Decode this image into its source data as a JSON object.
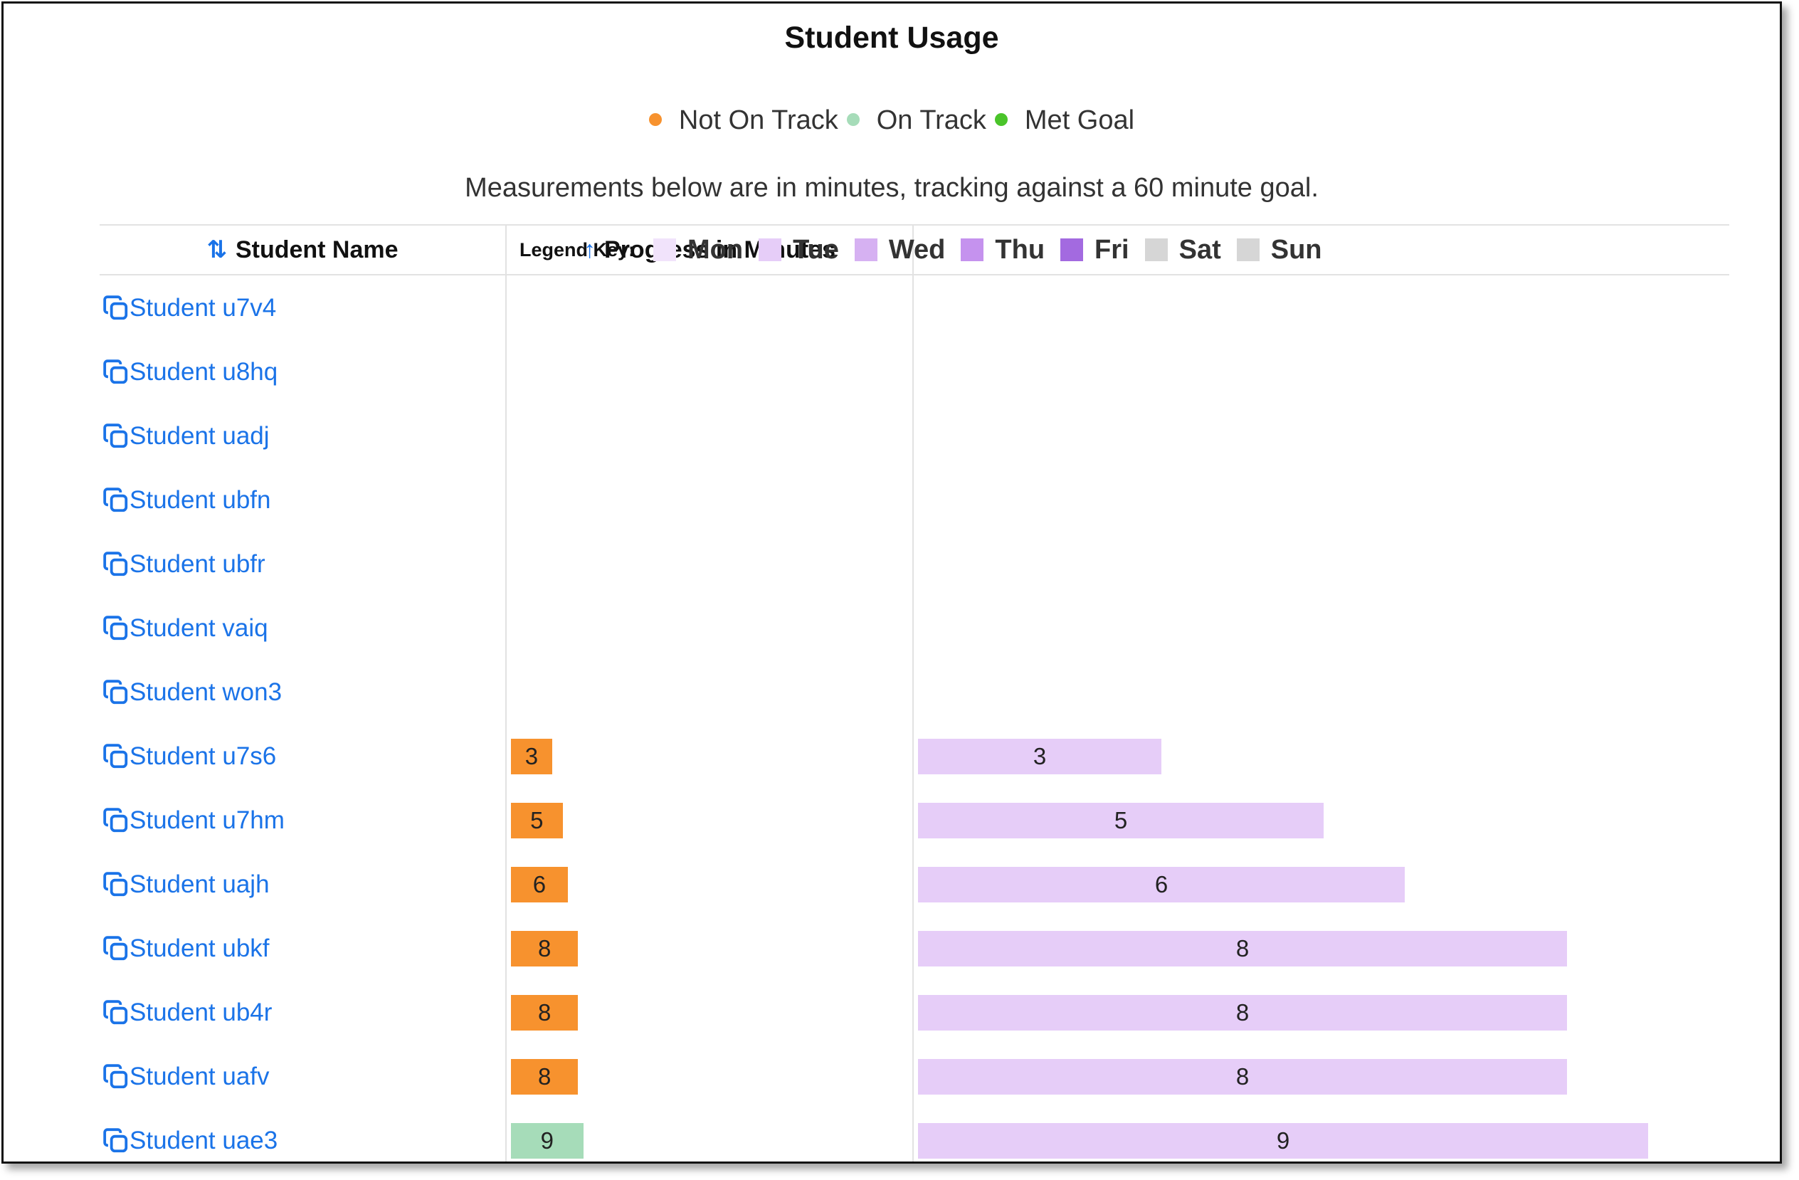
{
  "title": "Student Usage",
  "status_legend": [
    {
      "label": "Not On Track",
      "color": "#f7922e"
    },
    {
      "label": "On Track",
      "color": "#a6dcb9"
    },
    {
      "label": "Met Goal",
      "color": "#4ac42a"
    }
  ],
  "note": "Measurements below are in minutes, tracking against a 60 minute goal.",
  "columns": {
    "student_name": "Student Name",
    "progress": "Progress in Minutes",
    "legend_key_label": "Legend Key:"
  },
  "day_legend": [
    {
      "label": "Mon",
      "color": "#f1e3fb"
    },
    {
      "label": "Tue",
      "color": "#e6cdf8"
    },
    {
      "label": "Wed",
      "color": "#d6b1f2"
    },
    {
      "label": "Thu",
      "color": "#c592ee"
    },
    {
      "label": "Fri",
      "color": "#a36ae0"
    },
    {
      "label": "Sat",
      "color": "#d6d6d6"
    },
    {
      "label": "Sun",
      "color": "#d6d6d6"
    }
  ],
  "goal_minutes": 60,
  "students": [
    {
      "name": "Student u7v4",
      "minutes": null,
      "status": null,
      "day": null
    },
    {
      "name": "Student u8hq",
      "minutes": null,
      "status": null,
      "day": null
    },
    {
      "name": "Student uadj",
      "minutes": null,
      "status": null,
      "day": null
    },
    {
      "name": "Student ubfn",
      "minutes": null,
      "status": null,
      "day": null
    },
    {
      "name": "Student ubfr",
      "minutes": null,
      "status": null,
      "day": null
    },
    {
      "name": "Student vaiq",
      "minutes": null,
      "status": null,
      "day": null
    },
    {
      "name": "Student won3",
      "minutes": null,
      "status": null,
      "day": null
    },
    {
      "name": "Student u7s6",
      "minutes": "3",
      "status": "Not On Track",
      "day": "Tue"
    },
    {
      "name": "Student u7hm",
      "minutes": "5",
      "status": "Not On Track",
      "day": "Tue"
    },
    {
      "name": "Student uajh",
      "minutes": "6",
      "status": "Not On Track",
      "day": "Tue"
    },
    {
      "name": "Student ubkf",
      "minutes": "8",
      "status": "Not On Track",
      "day": "Tue"
    },
    {
      "name": "Student ub4r",
      "minutes": "8",
      "status": "Not On Track",
      "day": "Tue"
    },
    {
      "name": "Student uafv",
      "minutes": "8",
      "status": "Not On Track",
      "day": "Tue"
    },
    {
      "name": "Student uae3",
      "minutes": "9",
      "status": "On Track",
      "day": "Tue"
    }
  ],
  "icons": {
    "name_sort": "sort-both-icon",
    "progress_sort": "sort-asc-icon",
    "student_link": "copy-icon"
  }
}
